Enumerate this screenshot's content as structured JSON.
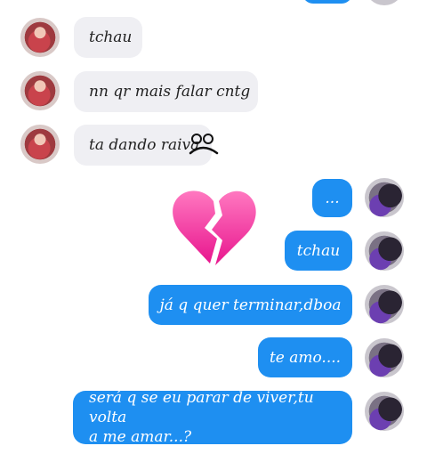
{
  "messages": [
    {
      "side": "left",
      "text": "tchau"
    },
    {
      "side": "left",
      "text": "nn qr mais falar cntg"
    },
    {
      "side": "left",
      "text": "ta dando raiva"
    },
    {
      "side": "right",
      "text": "..."
    },
    {
      "side": "right",
      "text": "tchau"
    },
    {
      "side": "right",
      "text": "já q quer terminar,dboa"
    },
    {
      "side": "right",
      "text": "te amo...."
    },
    {
      "side": "right",
      "text_line1": "será q se eu parar de viver,tu volta",
      "text_line2": "a me amar...?"
    }
  ],
  "sticker": "broken-heart-emoji",
  "colors": {
    "sent": "#1e8ff1",
    "received": "#efeff3"
  }
}
